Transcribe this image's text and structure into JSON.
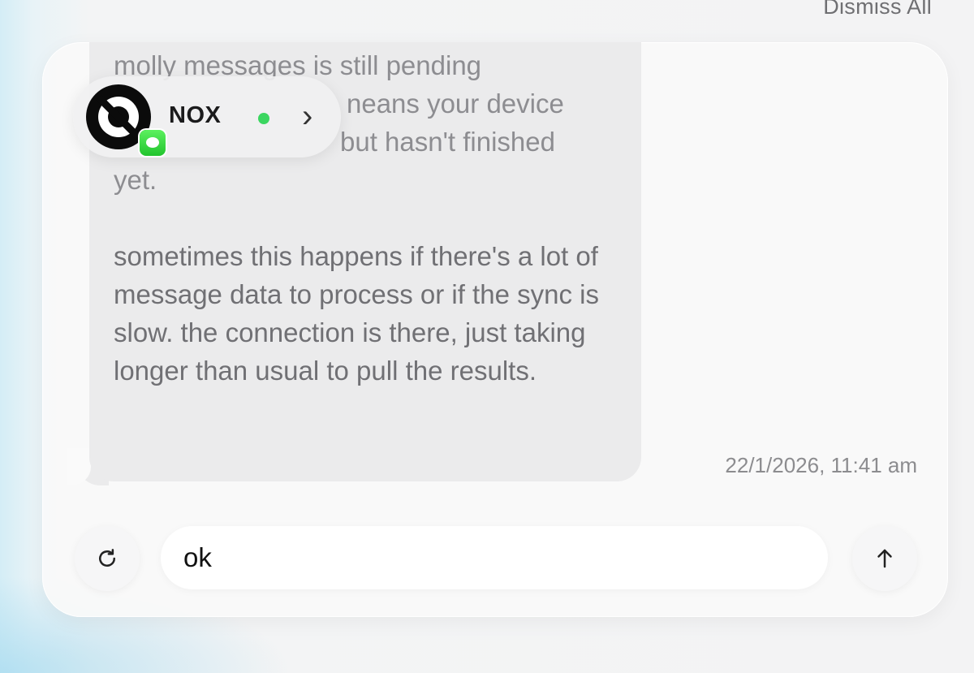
{
  "header": {
    "dismiss_all_label": "Dismiss All"
  },
  "chat": {
    "message_para1": "molly messages is still pending … means your device … but hasn't finished yet.",
    "message_para1_lines": [
      "molly messages is still pending",
      "neans your device",
      "but hasn't finished",
      "yet."
    ],
    "message_para2": "sometimes this happens if there's a lot of message data to process or if the sync is slow. the connection is there, just taking longer than usual to pull the results.",
    "timestamp": "22/1/2026, 11:41 am"
  },
  "contact_pill": {
    "name": "NOX",
    "status": "online",
    "status_color": "#3bd660",
    "avatar_icon": "nox-logo-icon",
    "badge_icon": "messages-app-icon",
    "chevron_icon": "chevron-right-icon"
  },
  "composer": {
    "input_value": "ok",
    "retry_icon": "refresh-icon",
    "send_icon": "arrow-up-icon"
  }
}
